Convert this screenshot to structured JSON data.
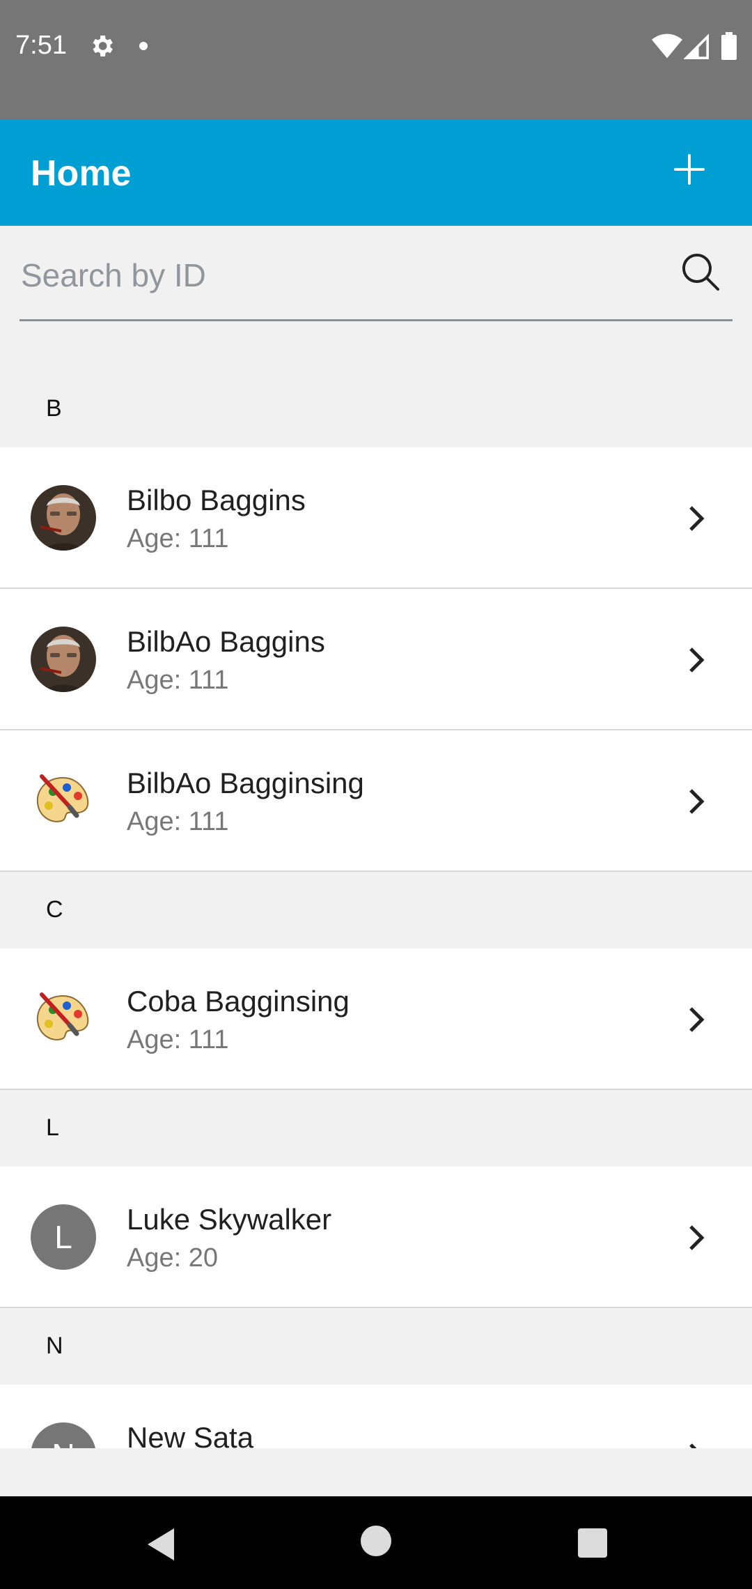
{
  "status_bar": {
    "time": "7:51",
    "icons": [
      "gear-icon",
      "notification-dot-icon",
      "wifi-icon",
      "signal-icon",
      "battery-icon"
    ]
  },
  "app_bar": {
    "title": "Home",
    "add_icon": "plus-icon",
    "background_color": "#009fd3"
  },
  "search": {
    "placeholder": "Search by ID",
    "value": "",
    "icon": "search-icon"
  },
  "sections": [
    {
      "letter": "B",
      "items": [
        {
          "name": "Bilbo Baggins",
          "age": "Age: 111",
          "avatar": "photo"
        },
        {
          "name": "BilbAo Baggins",
          "age": "Age: 111",
          "avatar": "photo"
        },
        {
          "name": "BilbAo Bagginsing",
          "age": "Age: 111",
          "avatar": "palette-icon"
        }
      ]
    },
    {
      "letter": "C",
      "items": [
        {
          "name": "Coba Bagginsing",
          "age": "Age: 111",
          "avatar": "palette-icon"
        }
      ]
    },
    {
      "letter": "L",
      "items": [
        {
          "name": "Luke Skywalker",
          "age": "Age: 20",
          "avatar": "letter",
          "avatar_letter": "L"
        }
      ]
    },
    {
      "letter": "N",
      "items": [
        {
          "name": "New Sata",
          "age": "",
          "avatar": "letter",
          "avatar_letter": "N"
        }
      ]
    }
  ],
  "nav_bar": {
    "icons": [
      "back-icon",
      "home-icon",
      "recents-icon"
    ]
  }
}
